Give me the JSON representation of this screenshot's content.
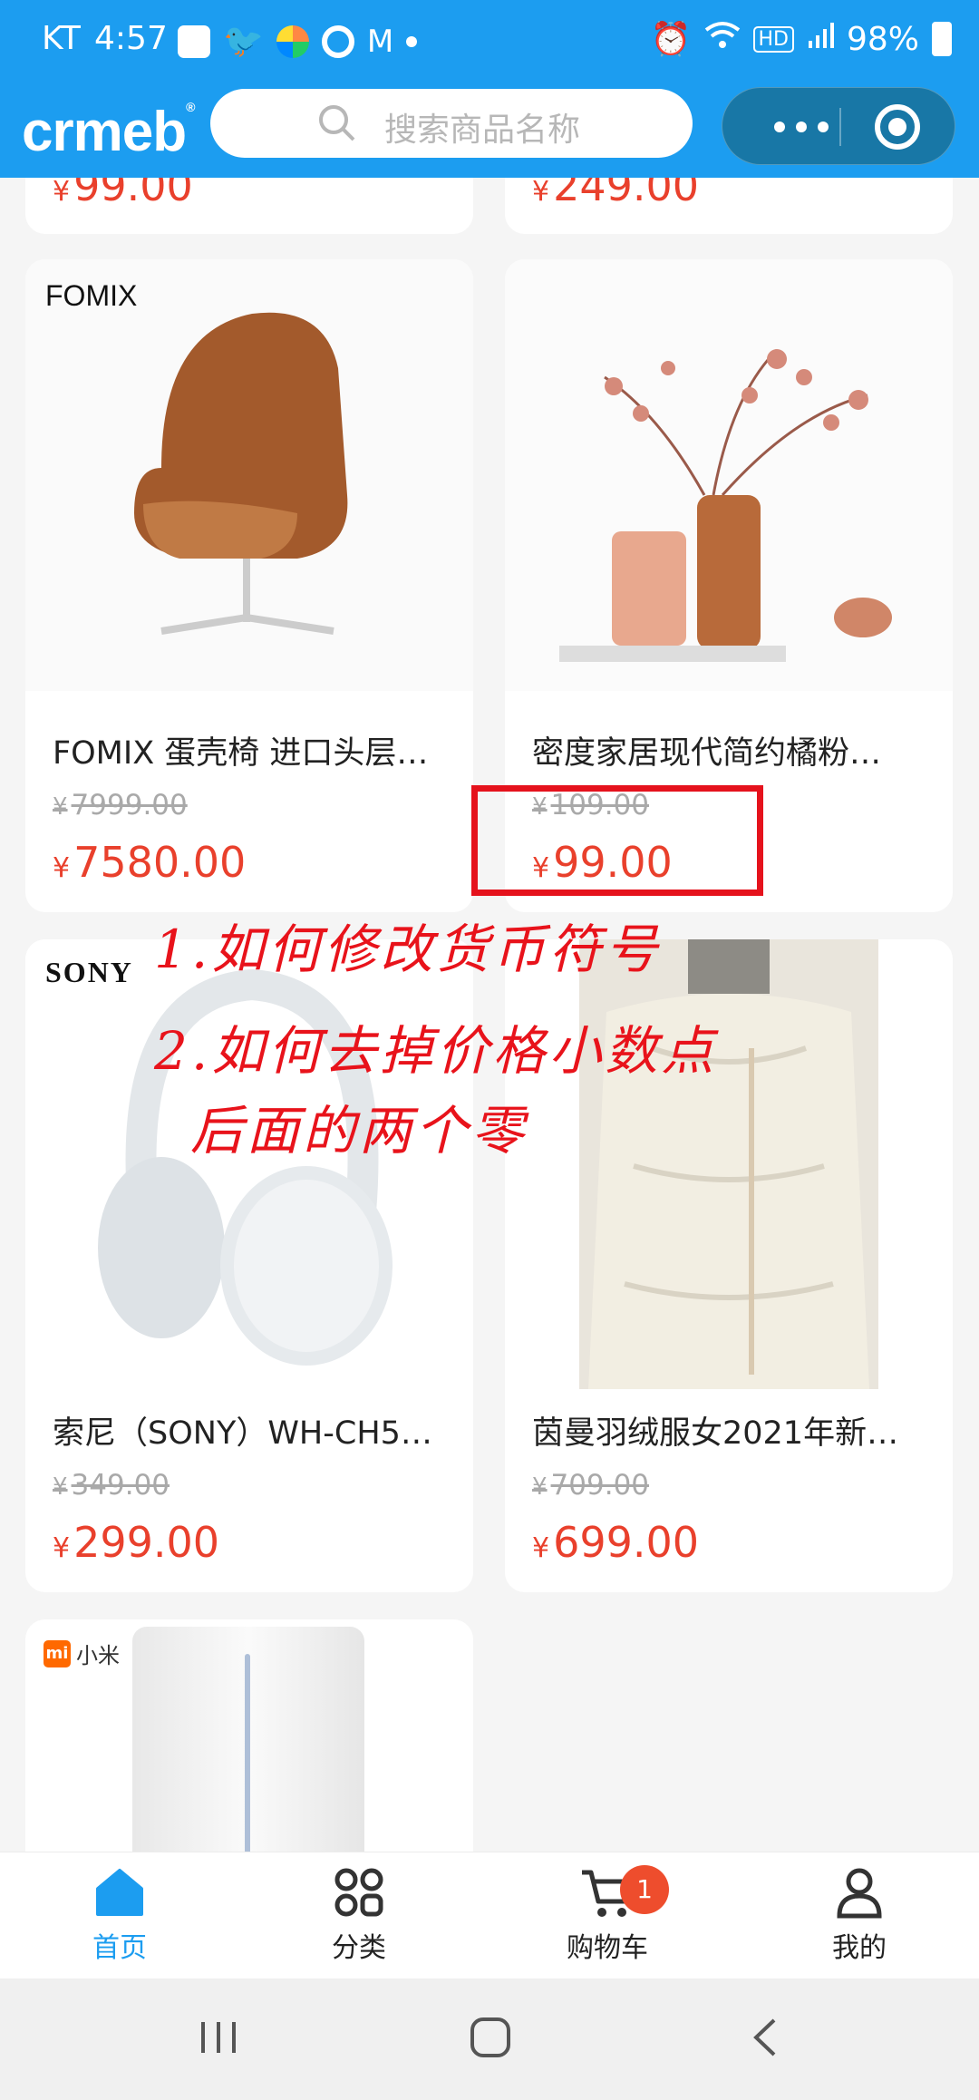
{
  "status": {
    "carrier": "KT",
    "time": "4:57",
    "hd": "HD",
    "battery": "98%"
  },
  "header": {
    "logo": "crmeb",
    "search_placeholder": "搜索商品名称"
  },
  "top_prices": [
    "99.00",
    "249.00"
  ],
  "products": [
    {
      "brand": "FOMIX",
      "title": "FOMIX 蛋壳椅 进口头层…",
      "orig": "7999.00",
      "price": "7580.00"
    },
    {
      "brand": "",
      "title": "密度家居现代简约橘粉…",
      "orig": "109.00",
      "price": "99.00"
    },
    {
      "brand": "SONY",
      "title": "索尼（SONY）WH-CH5…",
      "orig": "349.00",
      "price": "299.00"
    },
    {
      "brand": "",
      "title": "茵曼羽绒服女2021年新…",
      "orig": "709.00",
      "price": "699.00"
    },
    {
      "brand": "小米",
      "title": "",
      "orig": "",
      "price": ""
    }
  ],
  "currency": "¥",
  "annotation": {
    "line1": "1.如何修改货币符号",
    "line2": "2.如何去掉价格小数点",
    "line3": "后面的两个零"
  },
  "tabs": [
    {
      "label": "首页",
      "active": true
    },
    {
      "label": "分类"
    },
    {
      "label": "购物车",
      "badge": "1"
    },
    {
      "label": "我的"
    }
  ],
  "colors": {
    "primary": "#1c9df0",
    "price": "#e9402c",
    "annotation": "#e5121c"
  }
}
